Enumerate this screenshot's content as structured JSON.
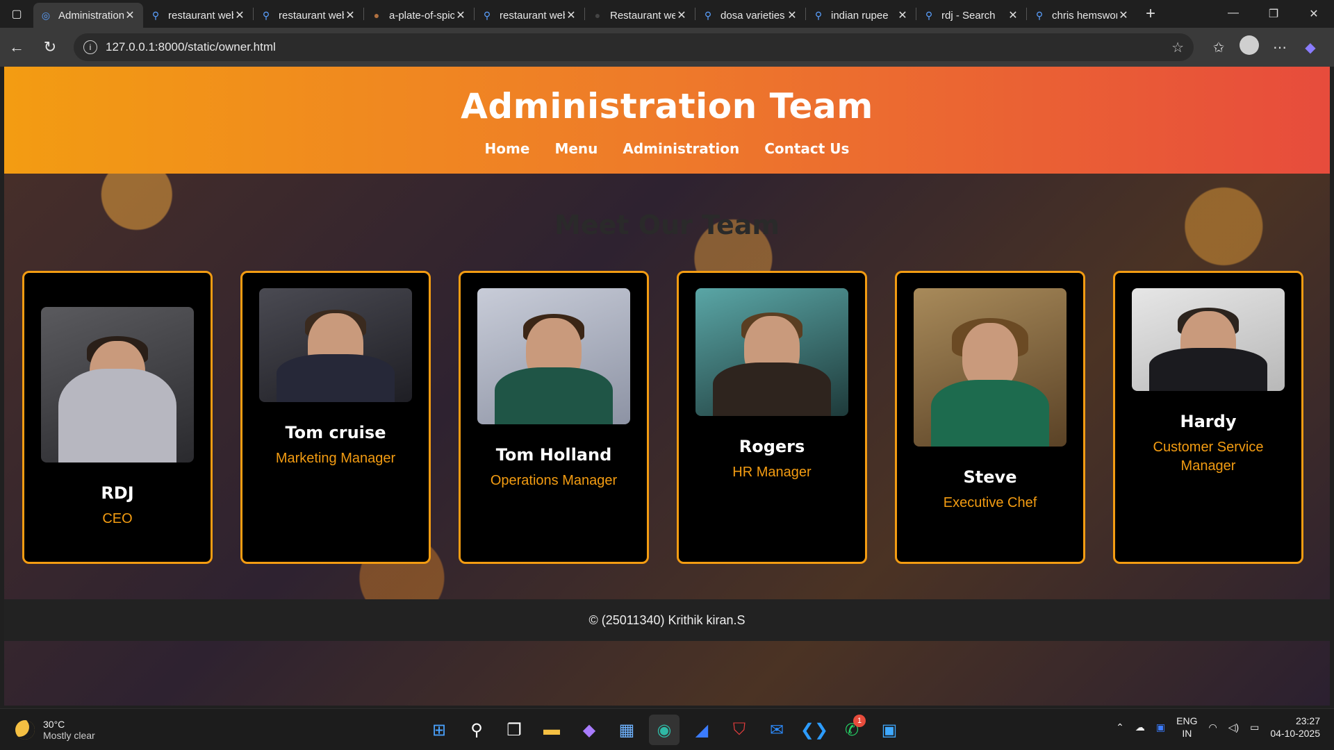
{
  "browser": {
    "tabs": [
      {
        "title": "Administration Team",
        "active": true
      },
      {
        "title": "restaurant website"
      },
      {
        "title": "restaurant website"
      },
      {
        "title": "a-plate-of-spicy"
      },
      {
        "title": "restaurant website"
      },
      {
        "title": "Restaurant website"
      },
      {
        "title": "dosa varieties"
      },
      {
        "title": "indian rupee"
      },
      {
        "title": "rdj - Search"
      },
      {
        "title": "chris hemsworth"
      }
    ],
    "url": "127.0.0.1:8000/static/owner.html"
  },
  "page": {
    "title": "Administration Team",
    "nav": [
      "Home",
      "Menu",
      "Administration",
      "Contact Us"
    ],
    "section_title": "Meet Our Team",
    "team": [
      {
        "name": "RDJ",
        "role": "CEO"
      },
      {
        "name": "Tom cruise",
        "role": "Marketing Manager"
      },
      {
        "name": "Tom Holland",
        "role": "Operations Manager"
      },
      {
        "name": "Rogers",
        "role": "HR Manager"
      },
      {
        "name": "Steve",
        "role": "Executive Chef"
      },
      {
        "name": "Hardy",
        "role": "Customer Service Manager"
      }
    ],
    "footer": "© (25011340) Krithik kiran.S"
  },
  "taskbar": {
    "weather_temp": "30°C",
    "weather_desc": "Mostly clear",
    "lang_1": "ENG",
    "lang_2": "IN",
    "time": "23:27",
    "date": "04-10-2025",
    "whatsapp_badge": "1"
  },
  "colors": {
    "accent": "#f39c12",
    "header_end": "#e74c3c"
  }
}
